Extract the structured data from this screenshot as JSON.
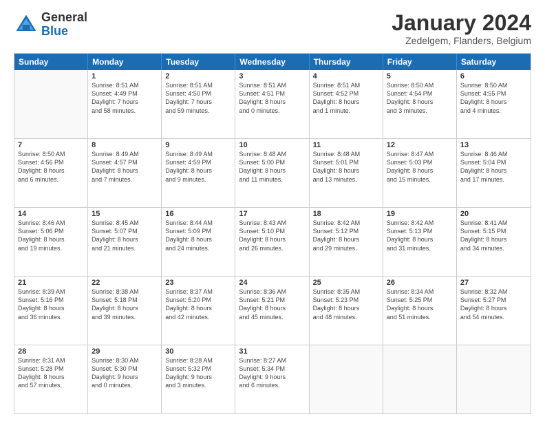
{
  "header": {
    "logo_general": "General",
    "logo_blue": "Blue",
    "month_title": "January 2024",
    "subtitle": "Zedelgem, Flanders, Belgium"
  },
  "weekdays": [
    "Sunday",
    "Monday",
    "Tuesday",
    "Wednesday",
    "Thursday",
    "Friday",
    "Saturday"
  ],
  "rows": [
    [
      {
        "day": "",
        "lines": []
      },
      {
        "day": "1",
        "lines": [
          "Sunrise: 8:51 AM",
          "Sunset: 4:49 PM",
          "Daylight: 7 hours",
          "and 58 minutes."
        ]
      },
      {
        "day": "2",
        "lines": [
          "Sunrise: 8:51 AM",
          "Sunset: 4:50 PM",
          "Daylight: 7 hours",
          "and 59 minutes."
        ]
      },
      {
        "day": "3",
        "lines": [
          "Sunrise: 8:51 AM",
          "Sunset: 4:51 PM",
          "Daylight: 8 hours",
          "and 0 minutes."
        ]
      },
      {
        "day": "4",
        "lines": [
          "Sunrise: 8:51 AM",
          "Sunset: 4:52 PM",
          "Daylight: 8 hours",
          "and 1 minute."
        ]
      },
      {
        "day": "5",
        "lines": [
          "Sunrise: 8:50 AM",
          "Sunset: 4:54 PM",
          "Daylight: 8 hours",
          "and 3 minutes."
        ]
      },
      {
        "day": "6",
        "lines": [
          "Sunrise: 8:50 AM",
          "Sunset: 4:55 PM",
          "Daylight: 8 hours",
          "and 4 minutes."
        ]
      }
    ],
    [
      {
        "day": "7",
        "lines": [
          "Sunrise: 8:50 AM",
          "Sunset: 4:56 PM",
          "Daylight: 8 hours",
          "and 6 minutes."
        ]
      },
      {
        "day": "8",
        "lines": [
          "Sunrise: 8:49 AM",
          "Sunset: 4:57 PM",
          "Daylight: 8 hours",
          "and 7 minutes."
        ]
      },
      {
        "day": "9",
        "lines": [
          "Sunrise: 8:49 AM",
          "Sunset: 4:59 PM",
          "Daylight: 8 hours",
          "and 9 minutes."
        ]
      },
      {
        "day": "10",
        "lines": [
          "Sunrise: 8:48 AM",
          "Sunset: 5:00 PM",
          "Daylight: 8 hours",
          "and 11 minutes."
        ]
      },
      {
        "day": "11",
        "lines": [
          "Sunrise: 8:48 AM",
          "Sunset: 5:01 PM",
          "Daylight: 8 hours",
          "and 13 minutes."
        ]
      },
      {
        "day": "12",
        "lines": [
          "Sunrise: 8:47 AM",
          "Sunset: 5:03 PM",
          "Daylight: 8 hours",
          "and 15 minutes."
        ]
      },
      {
        "day": "13",
        "lines": [
          "Sunrise: 8:46 AM",
          "Sunset: 5:04 PM",
          "Daylight: 8 hours",
          "and 17 minutes."
        ]
      }
    ],
    [
      {
        "day": "14",
        "lines": [
          "Sunrise: 8:46 AM",
          "Sunset: 5:06 PM",
          "Daylight: 8 hours",
          "and 19 minutes."
        ]
      },
      {
        "day": "15",
        "lines": [
          "Sunrise: 8:45 AM",
          "Sunset: 5:07 PM",
          "Daylight: 8 hours",
          "and 21 minutes."
        ]
      },
      {
        "day": "16",
        "lines": [
          "Sunrise: 8:44 AM",
          "Sunset: 5:09 PM",
          "Daylight: 8 hours",
          "and 24 minutes."
        ]
      },
      {
        "day": "17",
        "lines": [
          "Sunrise: 8:43 AM",
          "Sunset: 5:10 PM",
          "Daylight: 8 hours",
          "and 26 minutes."
        ]
      },
      {
        "day": "18",
        "lines": [
          "Sunrise: 8:42 AM",
          "Sunset: 5:12 PM",
          "Daylight: 8 hours",
          "and 29 minutes."
        ]
      },
      {
        "day": "19",
        "lines": [
          "Sunrise: 8:42 AM",
          "Sunset: 5:13 PM",
          "Daylight: 8 hours",
          "and 31 minutes."
        ]
      },
      {
        "day": "20",
        "lines": [
          "Sunrise: 8:41 AM",
          "Sunset: 5:15 PM",
          "Daylight: 8 hours",
          "and 34 minutes."
        ]
      }
    ],
    [
      {
        "day": "21",
        "lines": [
          "Sunrise: 8:39 AM",
          "Sunset: 5:16 PM",
          "Daylight: 8 hours",
          "and 36 minutes."
        ]
      },
      {
        "day": "22",
        "lines": [
          "Sunrise: 8:38 AM",
          "Sunset: 5:18 PM",
          "Daylight: 8 hours",
          "and 39 minutes."
        ]
      },
      {
        "day": "23",
        "lines": [
          "Sunrise: 8:37 AM",
          "Sunset: 5:20 PM",
          "Daylight: 8 hours",
          "and 42 minutes."
        ]
      },
      {
        "day": "24",
        "lines": [
          "Sunrise: 8:36 AM",
          "Sunset: 5:21 PM",
          "Daylight: 8 hours",
          "and 45 minutes."
        ]
      },
      {
        "day": "25",
        "lines": [
          "Sunrise: 8:35 AM",
          "Sunset: 5:23 PM",
          "Daylight: 8 hours",
          "and 48 minutes."
        ]
      },
      {
        "day": "26",
        "lines": [
          "Sunrise: 8:34 AM",
          "Sunset: 5:25 PM",
          "Daylight: 8 hours",
          "and 51 minutes."
        ]
      },
      {
        "day": "27",
        "lines": [
          "Sunrise: 8:32 AM",
          "Sunset: 5:27 PM",
          "Daylight: 8 hours",
          "and 54 minutes."
        ]
      }
    ],
    [
      {
        "day": "28",
        "lines": [
          "Sunrise: 8:31 AM",
          "Sunset: 5:28 PM",
          "Daylight: 8 hours",
          "and 57 minutes."
        ]
      },
      {
        "day": "29",
        "lines": [
          "Sunrise: 8:30 AM",
          "Sunset: 5:30 PM",
          "Daylight: 9 hours",
          "and 0 minutes."
        ]
      },
      {
        "day": "30",
        "lines": [
          "Sunrise: 8:28 AM",
          "Sunset: 5:32 PM",
          "Daylight: 9 hours",
          "and 3 minutes."
        ]
      },
      {
        "day": "31",
        "lines": [
          "Sunrise: 8:27 AM",
          "Sunset: 5:34 PM",
          "Daylight: 9 hours",
          "and 6 minutes."
        ]
      },
      {
        "day": "",
        "lines": []
      },
      {
        "day": "",
        "lines": []
      },
      {
        "day": "",
        "lines": []
      }
    ]
  ]
}
